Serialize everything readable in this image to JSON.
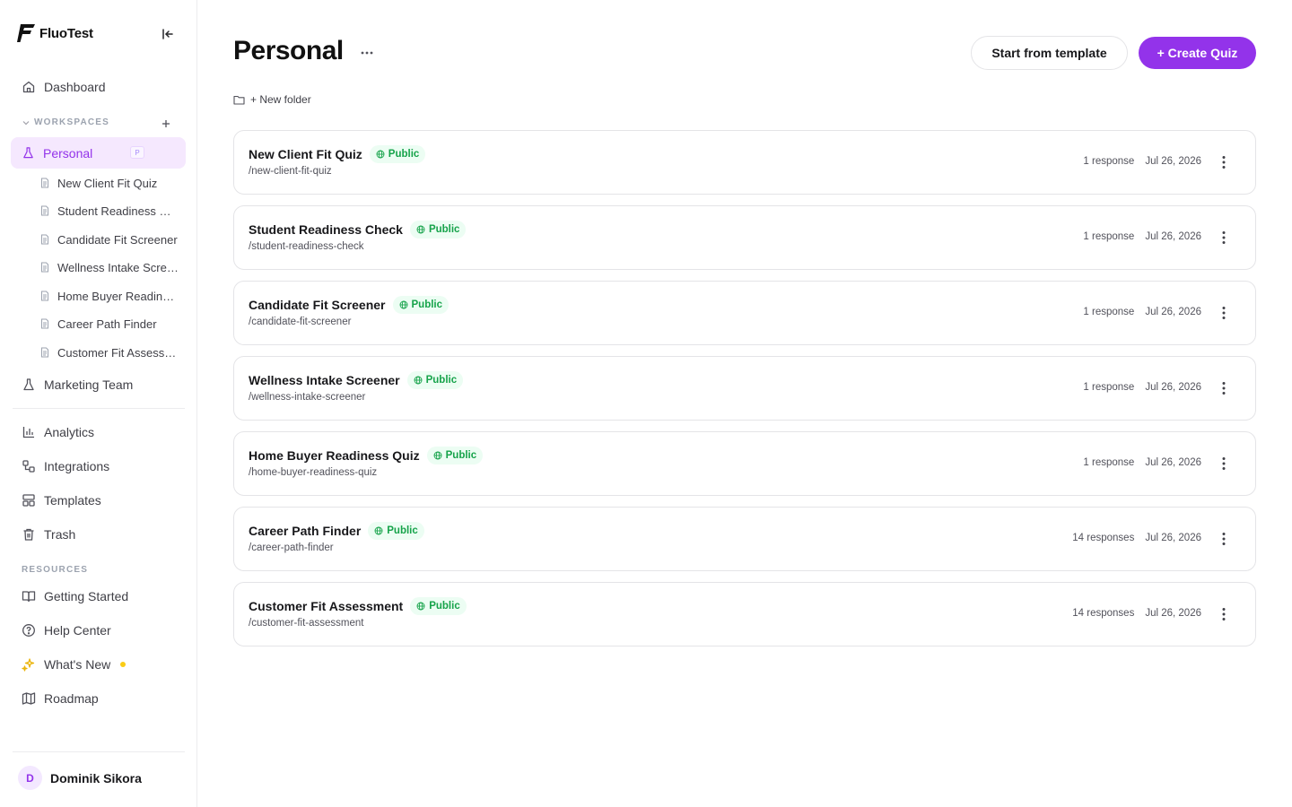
{
  "brand": {
    "name": "FluoTest"
  },
  "sidebar": {
    "dashboard_label": "Dashboard",
    "workspaces_label": "WORKSPACES",
    "personal": {
      "label": "Personal",
      "badge": "P"
    },
    "personal_items": [
      {
        "label": "New Client Fit Quiz"
      },
      {
        "label": "Student Readiness Check"
      },
      {
        "label": "Candidate Fit Screener"
      },
      {
        "label": "Wellness Intake Screener"
      },
      {
        "label": "Home Buyer Readiness Quiz"
      },
      {
        "label": "Career Path Finder"
      },
      {
        "label": "Customer Fit Assessment"
      }
    ],
    "marketing_label": "Marketing Team",
    "tools": [
      {
        "label": "Analytics",
        "icon": "bar-chart-icon"
      },
      {
        "label": "Integrations",
        "icon": "integrations-icon"
      },
      {
        "label": "Templates",
        "icon": "templates-icon"
      },
      {
        "label": "Trash",
        "icon": "trash-icon"
      }
    ],
    "resources_label": "RESOURCES",
    "resources": [
      {
        "label": "Getting Started",
        "icon": "book-icon"
      },
      {
        "label": "Help Center",
        "icon": "help-circle-icon"
      },
      {
        "label": "What's New",
        "icon": "sparkles-icon"
      },
      {
        "label": "Roadmap",
        "icon": "map-icon"
      }
    ],
    "user": {
      "initial": "D",
      "name": "Dominik Sikora"
    }
  },
  "header": {
    "title": "Personal",
    "template_button": "Start from template",
    "create_button": "+ Create Quiz",
    "new_folder": "+ New folder"
  },
  "quizzes": [
    {
      "name": "New Client Fit Quiz",
      "status": "Public",
      "slug": "/new-client-fit-quiz",
      "responses": "1 response",
      "date": "Jul 26, 2026"
    },
    {
      "name": "Student Readiness Check",
      "status": "Public",
      "slug": "/student-readiness-check",
      "responses": "1 response",
      "date": "Jul 26, 2026"
    },
    {
      "name": "Candidate Fit Screener",
      "status": "Public",
      "slug": "/candidate-fit-screener",
      "responses": "1 response",
      "date": "Jul 26, 2026"
    },
    {
      "name": "Wellness Intake Screener",
      "status": "Public",
      "slug": "/wellness-intake-screener",
      "responses": "1 response",
      "date": "Jul 26, 2026"
    },
    {
      "name": "Home Buyer Readiness Quiz",
      "status": "Public",
      "slug": "/home-buyer-readiness-quiz",
      "responses": "1 response",
      "date": "Jul 26, 2026"
    },
    {
      "name": "Career Path Finder",
      "status": "Public",
      "slug": "/career-path-finder",
      "responses": "14 responses",
      "date": "Jul 26, 2026"
    },
    {
      "name": "Customer Fit Assessment",
      "status": "Public",
      "slug": "/customer-fit-assessment",
      "responses": "14 responses",
      "date": "Jul 26, 2026"
    }
  ],
  "colors": {
    "accent": "#9333ea",
    "accent_bg": "#f5e8fe",
    "public_text": "#16a34a",
    "public_bg": "#ecfdf3",
    "border": "#e4e4e7"
  }
}
